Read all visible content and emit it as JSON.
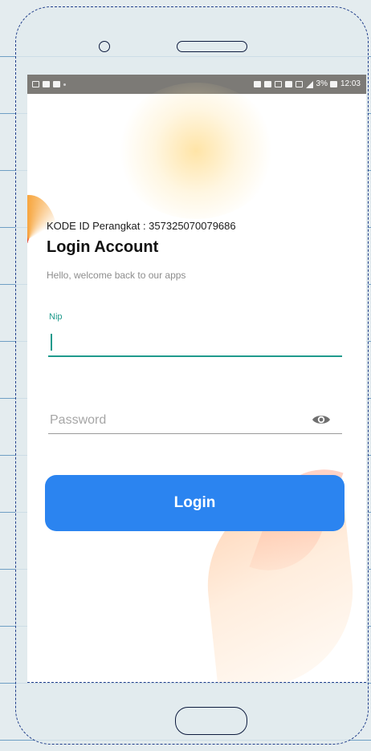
{
  "status_bar": {
    "battery": "3%",
    "time": "12:03"
  },
  "header": {
    "device_id_text": "KODE ID Perangkat : 357325070079686",
    "title": "Login Account",
    "subtitle": "Hello, welcome back to our apps"
  },
  "form": {
    "nip_label": "Nip",
    "nip_value": "",
    "password_placeholder": "Password",
    "password_value": "",
    "password_toggle_icon": "eye-icon",
    "login_label": "Login"
  },
  "colors": {
    "accent_teal": "#1f9a8c",
    "button_blue": "#2b84f0",
    "status_bar_gray": "#7c7a76"
  }
}
